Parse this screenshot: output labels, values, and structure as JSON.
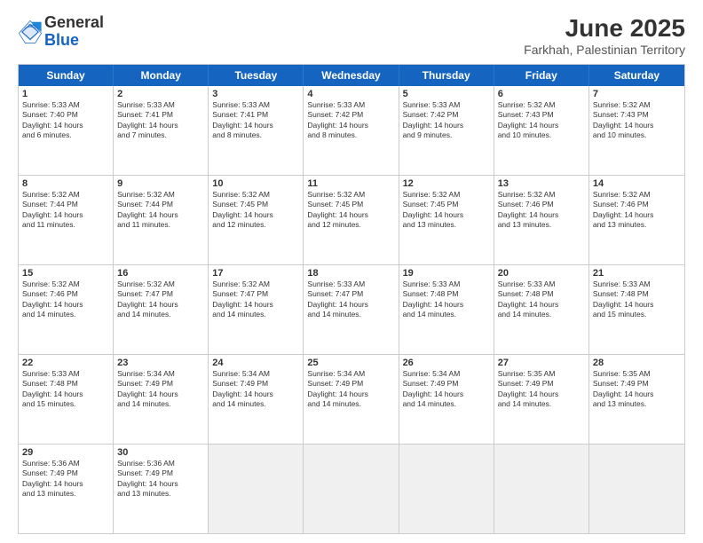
{
  "header": {
    "logo_general": "General",
    "logo_blue": "Blue",
    "month": "June 2025",
    "location": "Farkhah, Palestinian Territory"
  },
  "days": [
    "Sunday",
    "Monday",
    "Tuesday",
    "Wednesday",
    "Thursday",
    "Friday",
    "Saturday"
  ],
  "rows": [
    [
      {
        "num": "1",
        "lines": [
          "Sunrise: 5:33 AM",
          "Sunset: 7:40 PM",
          "Daylight: 14 hours",
          "and 6 minutes."
        ]
      },
      {
        "num": "2",
        "lines": [
          "Sunrise: 5:33 AM",
          "Sunset: 7:41 PM",
          "Daylight: 14 hours",
          "and 7 minutes."
        ]
      },
      {
        "num": "3",
        "lines": [
          "Sunrise: 5:33 AM",
          "Sunset: 7:41 PM",
          "Daylight: 14 hours",
          "and 8 minutes."
        ]
      },
      {
        "num": "4",
        "lines": [
          "Sunrise: 5:33 AM",
          "Sunset: 7:42 PM",
          "Daylight: 14 hours",
          "and 8 minutes."
        ]
      },
      {
        "num": "5",
        "lines": [
          "Sunrise: 5:33 AM",
          "Sunset: 7:42 PM",
          "Daylight: 14 hours",
          "and 9 minutes."
        ]
      },
      {
        "num": "6",
        "lines": [
          "Sunrise: 5:32 AM",
          "Sunset: 7:43 PM",
          "Daylight: 14 hours",
          "and 10 minutes."
        ]
      },
      {
        "num": "7",
        "lines": [
          "Sunrise: 5:32 AM",
          "Sunset: 7:43 PM",
          "Daylight: 14 hours",
          "and 10 minutes."
        ]
      }
    ],
    [
      {
        "num": "8",
        "lines": [
          "Sunrise: 5:32 AM",
          "Sunset: 7:44 PM",
          "Daylight: 14 hours",
          "and 11 minutes."
        ]
      },
      {
        "num": "9",
        "lines": [
          "Sunrise: 5:32 AM",
          "Sunset: 7:44 PM",
          "Daylight: 14 hours",
          "and 11 minutes."
        ]
      },
      {
        "num": "10",
        "lines": [
          "Sunrise: 5:32 AM",
          "Sunset: 7:45 PM",
          "Daylight: 14 hours",
          "and 12 minutes."
        ]
      },
      {
        "num": "11",
        "lines": [
          "Sunrise: 5:32 AM",
          "Sunset: 7:45 PM",
          "Daylight: 14 hours",
          "and 12 minutes."
        ]
      },
      {
        "num": "12",
        "lines": [
          "Sunrise: 5:32 AM",
          "Sunset: 7:45 PM",
          "Daylight: 14 hours",
          "and 13 minutes."
        ]
      },
      {
        "num": "13",
        "lines": [
          "Sunrise: 5:32 AM",
          "Sunset: 7:46 PM",
          "Daylight: 14 hours",
          "and 13 minutes."
        ]
      },
      {
        "num": "14",
        "lines": [
          "Sunrise: 5:32 AM",
          "Sunset: 7:46 PM",
          "Daylight: 14 hours",
          "and 13 minutes."
        ]
      }
    ],
    [
      {
        "num": "15",
        "lines": [
          "Sunrise: 5:32 AM",
          "Sunset: 7:46 PM",
          "Daylight: 14 hours",
          "and 14 minutes."
        ]
      },
      {
        "num": "16",
        "lines": [
          "Sunrise: 5:32 AM",
          "Sunset: 7:47 PM",
          "Daylight: 14 hours",
          "and 14 minutes."
        ]
      },
      {
        "num": "17",
        "lines": [
          "Sunrise: 5:32 AM",
          "Sunset: 7:47 PM",
          "Daylight: 14 hours",
          "and 14 minutes."
        ]
      },
      {
        "num": "18",
        "lines": [
          "Sunrise: 5:33 AM",
          "Sunset: 7:47 PM",
          "Daylight: 14 hours",
          "and 14 minutes."
        ]
      },
      {
        "num": "19",
        "lines": [
          "Sunrise: 5:33 AM",
          "Sunset: 7:48 PM",
          "Daylight: 14 hours",
          "and 14 minutes."
        ]
      },
      {
        "num": "20",
        "lines": [
          "Sunrise: 5:33 AM",
          "Sunset: 7:48 PM",
          "Daylight: 14 hours",
          "and 14 minutes."
        ]
      },
      {
        "num": "21",
        "lines": [
          "Sunrise: 5:33 AM",
          "Sunset: 7:48 PM",
          "Daylight: 14 hours",
          "and 15 minutes."
        ]
      }
    ],
    [
      {
        "num": "22",
        "lines": [
          "Sunrise: 5:33 AM",
          "Sunset: 7:48 PM",
          "Daylight: 14 hours",
          "and 15 minutes."
        ]
      },
      {
        "num": "23",
        "lines": [
          "Sunrise: 5:34 AM",
          "Sunset: 7:49 PM",
          "Daylight: 14 hours",
          "and 14 minutes."
        ]
      },
      {
        "num": "24",
        "lines": [
          "Sunrise: 5:34 AM",
          "Sunset: 7:49 PM",
          "Daylight: 14 hours",
          "and 14 minutes."
        ]
      },
      {
        "num": "25",
        "lines": [
          "Sunrise: 5:34 AM",
          "Sunset: 7:49 PM",
          "Daylight: 14 hours",
          "and 14 minutes."
        ]
      },
      {
        "num": "26",
        "lines": [
          "Sunrise: 5:34 AM",
          "Sunset: 7:49 PM",
          "Daylight: 14 hours",
          "and 14 minutes."
        ]
      },
      {
        "num": "27",
        "lines": [
          "Sunrise: 5:35 AM",
          "Sunset: 7:49 PM",
          "Daylight: 14 hours",
          "and 14 minutes."
        ]
      },
      {
        "num": "28",
        "lines": [
          "Sunrise: 5:35 AM",
          "Sunset: 7:49 PM",
          "Daylight: 14 hours",
          "and 13 minutes."
        ]
      }
    ],
    [
      {
        "num": "29",
        "lines": [
          "Sunrise: 5:36 AM",
          "Sunset: 7:49 PM",
          "Daylight: 14 hours",
          "and 13 minutes."
        ]
      },
      {
        "num": "30",
        "lines": [
          "Sunrise: 5:36 AM",
          "Sunset: 7:49 PM",
          "Daylight: 14 hours",
          "and 13 minutes."
        ]
      },
      {
        "num": "",
        "lines": [],
        "empty": true
      },
      {
        "num": "",
        "lines": [],
        "empty": true
      },
      {
        "num": "",
        "lines": [],
        "empty": true
      },
      {
        "num": "",
        "lines": [],
        "empty": true
      },
      {
        "num": "",
        "lines": [],
        "empty": true
      }
    ]
  ]
}
